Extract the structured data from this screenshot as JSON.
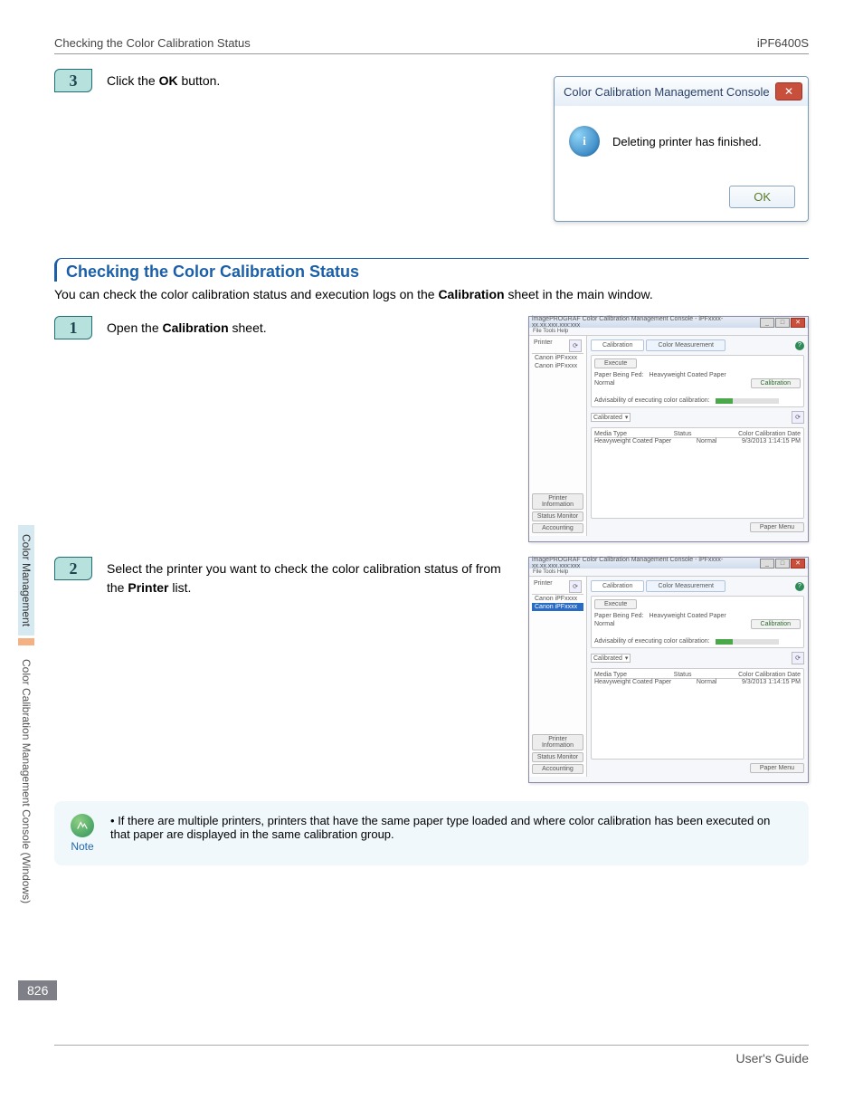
{
  "header": {
    "left": "Checking the Color Calibration Status",
    "right": "iPF6400S"
  },
  "sidebar": {
    "section1": "Color Management",
    "section2": "Color Calibration Management Console (Windows)"
  },
  "step3": {
    "num": "3",
    "text_before": "Click the ",
    "bold": "OK",
    "text_after": " button."
  },
  "dialog": {
    "title": "Color Calibration Management Console",
    "message": "Deleting printer has finished.",
    "ok": "OK"
  },
  "heading": "Checking the Color Calibration Status",
  "lede_before": "You can check the color calibration status and execution logs on the ",
  "lede_bold": "Calibration",
  "lede_after": " sheet in the main window.",
  "step1": {
    "num": "1",
    "text_before": "Open the ",
    "bold": "Calibration",
    "text_after": " sheet."
  },
  "step2": {
    "num": "2",
    "text_line": "Select the printer you want to check the color calibration status of from the ",
    "bold": "Printer",
    "text_after": " list."
  },
  "app": {
    "title": "imagePROGRAF Color Calibration Management Console - iPFxxxx-xx.xx.xxx.xxx:xxx",
    "menu": "File   Tools   Help",
    "printer_hdr": "Printer",
    "printer_items": [
      "Canon iPFxxxx",
      "Canon iPFxxxx"
    ],
    "tabs": {
      "calibration": "Calibration",
      "measure": "Color Measurement"
    },
    "execute": "Execute",
    "paper_feed_label": "Paper Being Fed:",
    "paper_feed_value": "Heavyweight Coated Paper",
    "normal": "Normal",
    "calib_btn": "Calibration",
    "advice": "Advisability of executing color calibration:",
    "calibrated": "Calibrated",
    "table": {
      "col1": "Media Type",
      "col2": "Status",
      "col3": "Color Calibration Date",
      "row_media": "Heavyweight Coated Paper",
      "row_status": "Normal",
      "row_date": "9/3/2013 1:14:15 PM"
    },
    "btn_info": "Printer Information",
    "btn_status": "Status Monitor",
    "btn_acct": "Accounting",
    "paper_menu": "Paper Menu"
  },
  "note": {
    "label": "Note",
    "bullet": "•",
    "text": "If there are multiple printers, printers that have the same paper type loaded and where color calibration has been executed on that paper are displayed in the same calibration group."
  },
  "page_number": "826",
  "footer": "User's Guide"
}
